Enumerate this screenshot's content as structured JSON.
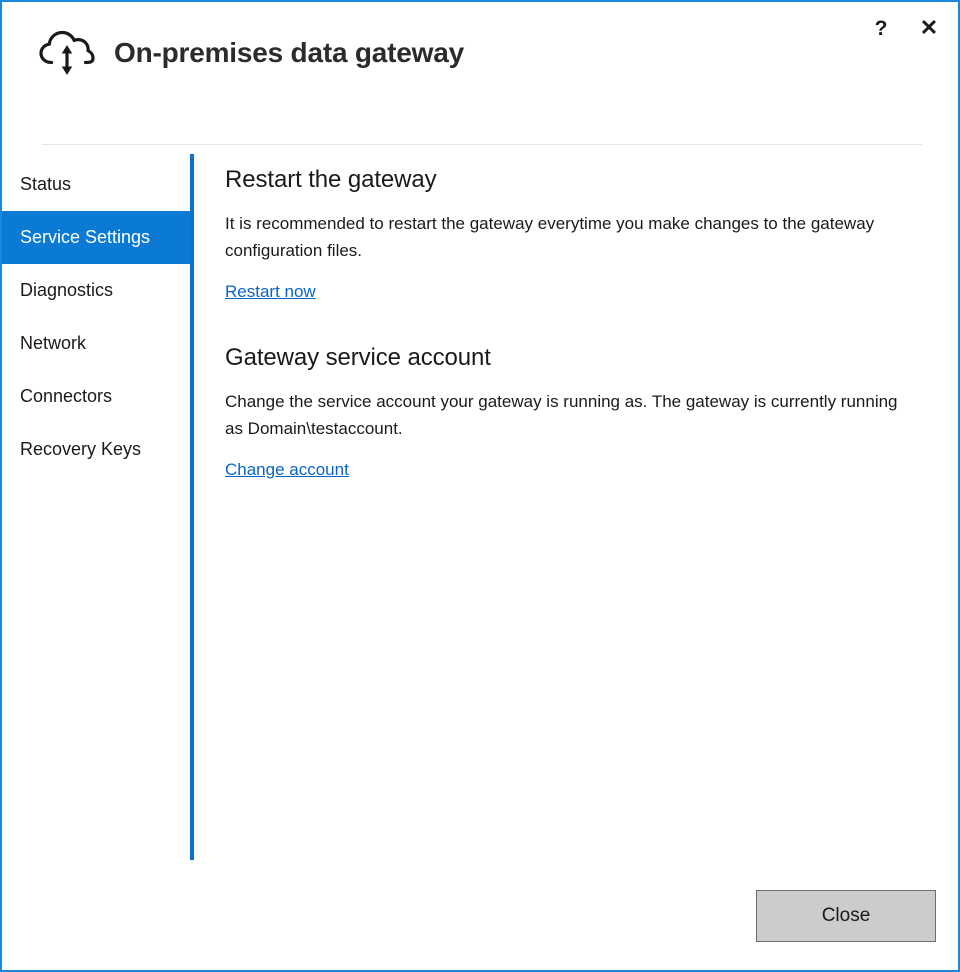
{
  "window": {
    "title": "On-premises data gateway",
    "accent_color": "#0b7ad4",
    "border_color": "#1b88e0",
    "app_icon": "cloud-sync-icon",
    "help_label": "?",
    "close_label": "✕"
  },
  "sidebar": {
    "items": [
      {
        "label": "Status",
        "selected": false
      },
      {
        "label": "Service Settings",
        "selected": true
      },
      {
        "label": "Diagnostics",
        "selected": false
      },
      {
        "label": "Network",
        "selected": false
      },
      {
        "label": "Connectors",
        "selected": false
      },
      {
        "label": "Recovery Keys",
        "selected": false
      }
    ]
  },
  "main": {
    "sections": [
      {
        "title": "Restart the gateway",
        "body": "It is recommended to restart the gateway everytime you make changes to the gateway configuration files.",
        "link": "Restart now"
      },
      {
        "title": "Gateway service account",
        "body": "Change the service account your gateway is running as. The gateway is currently running as Domain\\testaccount.",
        "link": "Change account"
      }
    ]
  },
  "footer": {
    "close_label": "Close"
  }
}
